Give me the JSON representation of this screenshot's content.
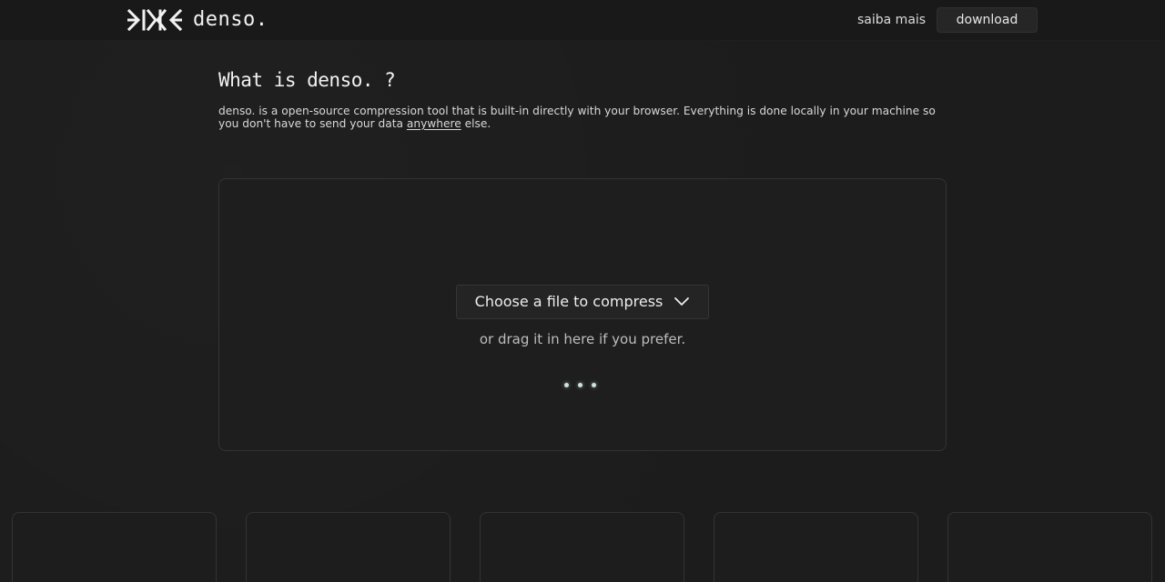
{
  "header": {
    "logo_text": "denso.",
    "nav_link": "saiba mais",
    "download_label": "download"
  },
  "intro": {
    "title": "What is denso. ?",
    "text_before_link": "denso. is a open-source compression tool that is built-in directly with your browser. Everything is done locally in your machine so you don't have to send your data ",
    "link_text": "anywhere",
    "text_after_link": " else."
  },
  "dropzone": {
    "choose_label": "Choose a file to compress",
    "drag_hint": "or drag it in here if you prefer."
  },
  "icons": {
    "logo": "denso-logo-icon",
    "choose": "chevron-down-icon",
    "loading": "loading-dots-icon"
  },
  "colors": {
    "background": "#1c1c1c",
    "header": "#191919",
    "panel": "#1e1e1e",
    "border": "#333333",
    "text": "#e6e6e6",
    "dot": "#cfe3da"
  },
  "cards_count_visible": 5
}
